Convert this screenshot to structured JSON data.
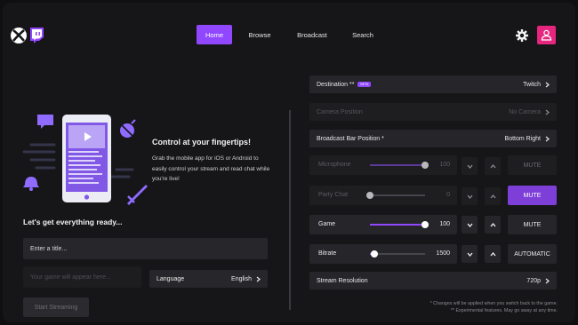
{
  "nav": {
    "items": [
      {
        "label": "Home",
        "active": true
      },
      {
        "label": "Browse",
        "active": false
      },
      {
        "label": "Broadcast",
        "active": false
      },
      {
        "label": "Search",
        "active": false
      }
    ]
  },
  "icons": {
    "xbox_logo": "xbox-logo",
    "twitch_logo": "twitch-logo",
    "settings": "gear-icon",
    "profile": "user-icon"
  },
  "colors": {
    "accent": "#9147ff",
    "accent_dark": "#7e3ed8",
    "avatar_bg": "#e6257e"
  },
  "promo": {
    "title": "Control at your fingertips!",
    "description": "Grab the mobile app for iOS or Android to easily control your stream and read chat while you're live!"
  },
  "setup": {
    "heading": "Let's get everything ready...",
    "title_field": "Enter a title...",
    "game_placeholder": "Your game will appear here...",
    "language_label": "Language",
    "language_value": "English",
    "start_button": "Start Streaming"
  },
  "settings": {
    "destination": {
      "label": "Destination **",
      "badge": "BETA",
      "value": "Twitch"
    },
    "camera_position": {
      "label": "Camera Position",
      "value": "No Camera"
    },
    "broadcast_bar_position": {
      "label": "Broadcast Bar Position *",
      "value": "Bottom Right"
    },
    "stream_resolution": {
      "label": "Stream Resolution",
      "value": "720p"
    }
  },
  "audio": [
    {
      "label": "Microphone",
      "value": "100",
      "level": 1.0,
      "button": "MUTE",
      "enabled": false,
      "button_active": false
    },
    {
      "label": "Party Chat",
      "value": "0",
      "level": 0.0,
      "button": "MUTE",
      "enabled": false,
      "button_active": true
    },
    {
      "label": "Game",
      "value": "100",
      "level": 1.0,
      "button": "MUTE",
      "enabled": true,
      "button_active": false
    },
    {
      "label": "Bitrate",
      "value": "1500",
      "level": 0.08,
      "button": "AUTOMATIC",
      "enabled": true,
      "button_active": false
    }
  ],
  "notes": {
    "line1": "* Changes will be applied when you switch back to the game.",
    "line2": "** Experimental features. May go away at any time."
  }
}
